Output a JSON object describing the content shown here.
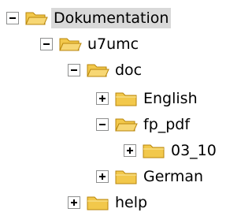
{
  "tree": {
    "items": [
      {
        "label": "Dokumentation",
        "toggle": "minus",
        "icon": "folder-open-icon",
        "selected": true
      },
      {
        "label": "u7umc",
        "toggle": "minus",
        "icon": "folder-open-icon"
      },
      {
        "label": "doc",
        "toggle": "minus",
        "icon": "folder-open-icon"
      },
      {
        "label": "English",
        "toggle": "plus",
        "icon": "folder-icon"
      },
      {
        "label": "fp_pdf",
        "toggle": "minus",
        "icon": "folder-open-icon"
      },
      {
        "label": "03_10",
        "toggle": "plus",
        "icon": "folder-icon"
      },
      {
        "label": "German",
        "toggle": "plus",
        "icon": "folder-icon"
      },
      {
        "label": "help",
        "toggle": "plus",
        "icon": "folder-icon"
      }
    ]
  },
  "colors": {
    "folder_fill": "#f2c84b",
    "folder_stroke": "#b8860b",
    "selection_background": "#d9d9d9"
  }
}
